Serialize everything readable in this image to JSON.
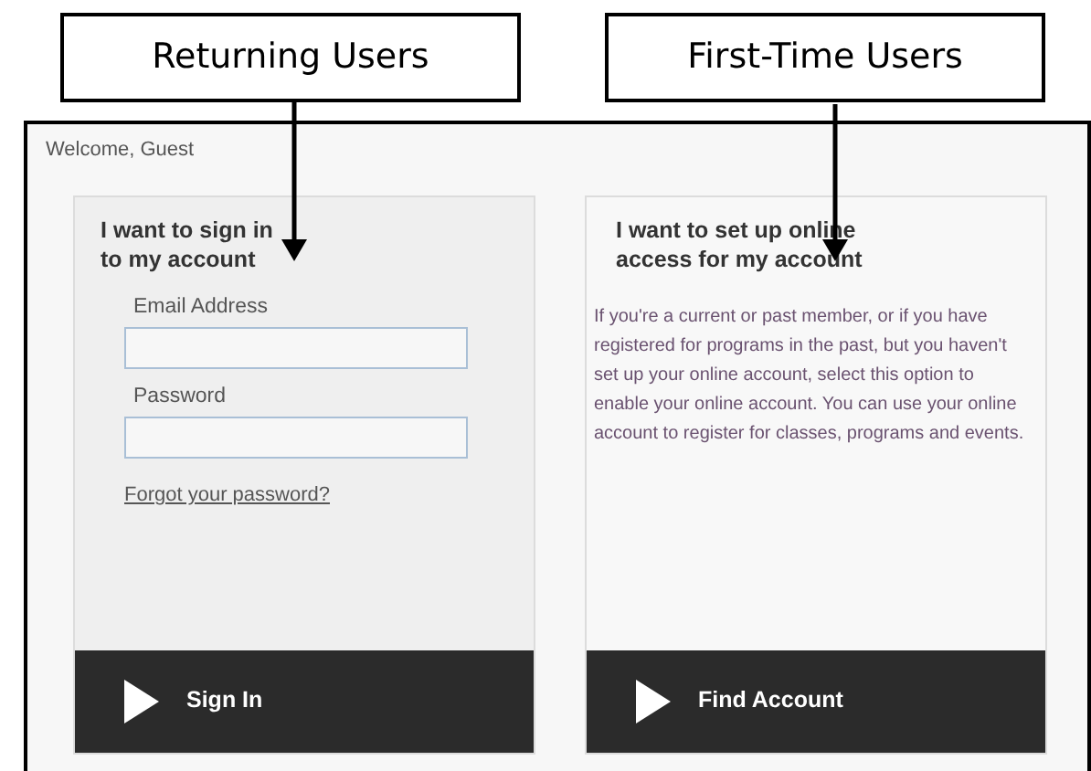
{
  "callouts": [
    {
      "label": "Returning Users"
    },
    {
      "label": "First-Time Users"
    }
  ],
  "header": {
    "greeting": "Welcome, Guest"
  },
  "cards": [
    {
      "kind": "signin",
      "heading_lines": [
        "I want to sign in",
        "to my account"
      ],
      "fields": [
        {
          "label": "Email Address"
        },
        {
          "label": "Password"
        }
      ],
      "link": "Forgot your password?",
      "button": "Sign In"
    },
    {
      "kind": "setup",
      "heading_lines": [
        "I want to set up online",
        "access for my account"
      ],
      "description": "If you're a current or past member, or if you have registered for programs in the past, but you haven't set up your online account, select this option to enable your online account. You can use your online account to register for classes, programs and events.",
      "button": "Find Account"
    }
  ]
}
